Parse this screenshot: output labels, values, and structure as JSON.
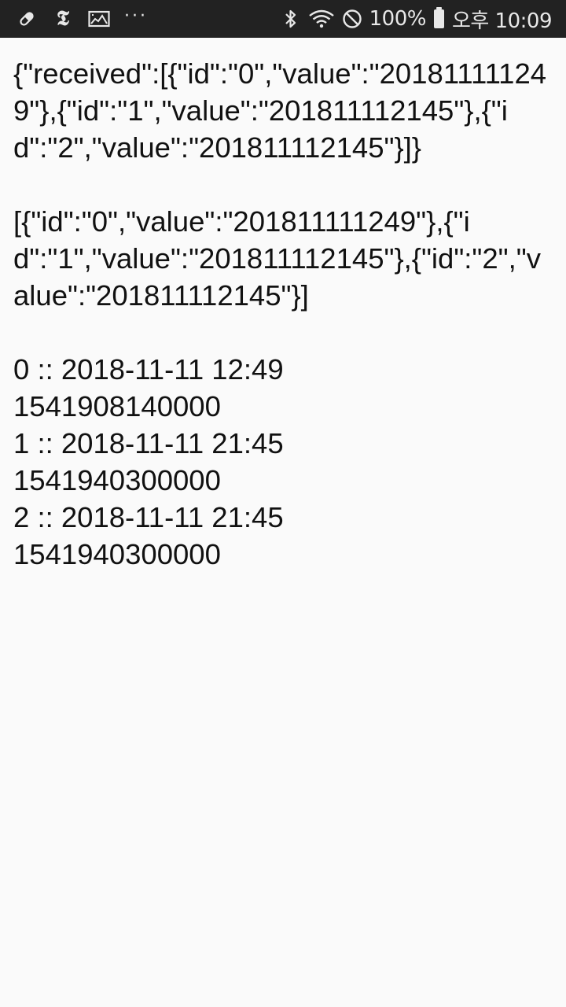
{
  "status_bar": {
    "left_icons": [
      "pill-icon",
      "nyt-icon",
      "gallery-icon",
      "more-notifications-icon"
    ],
    "nyt_glyph": "𝕿",
    "dots": "···",
    "battery_percent": "100%",
    "time": "오후 10:09"
  },
  "content": {
    "received_json": "{\"received\":[{\"id\":\"0\",\"value\":\"201811111249\"},{\"id\":\"1\",\"value\":\"201811112145\"},{\"id\":\"2\",\"value\":\"201811112145\"}]}",
    "array_json": "[{\"id\":\"0\",\"value\":\"201811111249\"},{\"id\":\"1\",\"value\":\"201811112145\"},{\"id\":\"2\",\"value\":\"201811112145\"}]",
    "entries": [
      {
        "label": "0 :: 2018-11-11 12:49",
        "timestamp": "1541908140000"
      },
      {
        "label": "1 :: 2018-11-11 21:45",
        "timestamp": "1541940300000"
      },
      {
        "label": "2 :: 2018-11-11 21:45",
        "timestamp": "1541940300000"
      }
    ]
  }
}
